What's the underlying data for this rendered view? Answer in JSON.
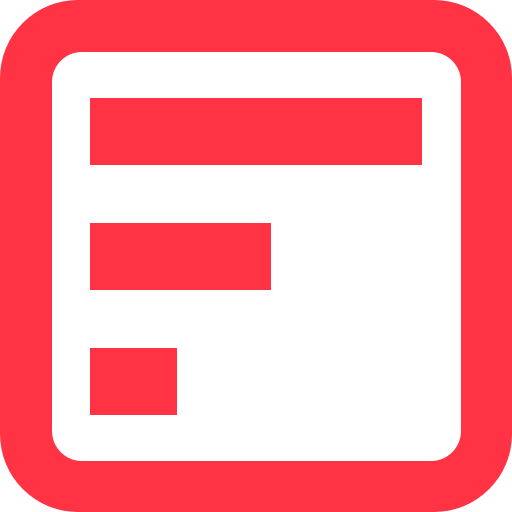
{
  "icon": {
    "name": "bar-list-app-icon",
    "colors": {
      "accent": "#FF3344",
      "inner_background": "#FFFFFF"
    },
    "bars": [
      {
        "label": "bar-1",
        "relative_length": 1.0
      },
      {
        "label": "bar-2",
        "relative_length": 0.545
      },
      {
        "label": "bar-3",
        "relative_length": 0.262
      }
    ]
  }
}
